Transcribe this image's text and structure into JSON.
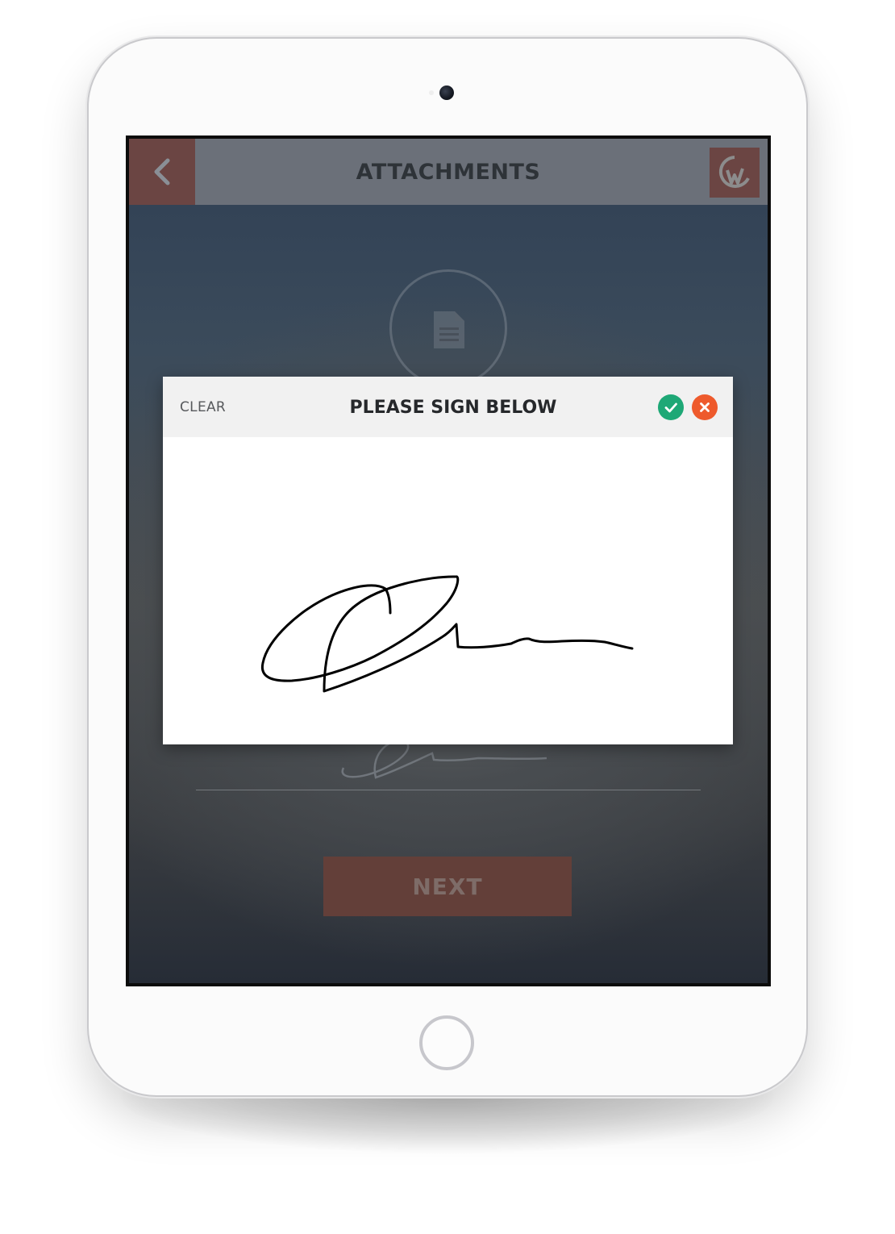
{
  "header": {
    "title": "ATTACHMENTS",
    "back_icon": "chevron-left-icon",
    "logo_icon": "app-logo-icon"
  },
  "background": {
    "document_icon": "document-icon"
  },
  "signature_modal": {
    "clear_label": "CLEAR",
    "title": "PLEASE SIGN BELOW",
    "confirm_icon": "check-icon",
    "cancel_icon": "close-icon"
  },
  "footer": {
    "next_label": "NEXT"
  },
  "colors": {
    "accent": "#6b4543",
    "header_bg": "#6b7079",
    "confirm": "#1ea876",
    "cancel": "#ee5a2c"
  }
}
